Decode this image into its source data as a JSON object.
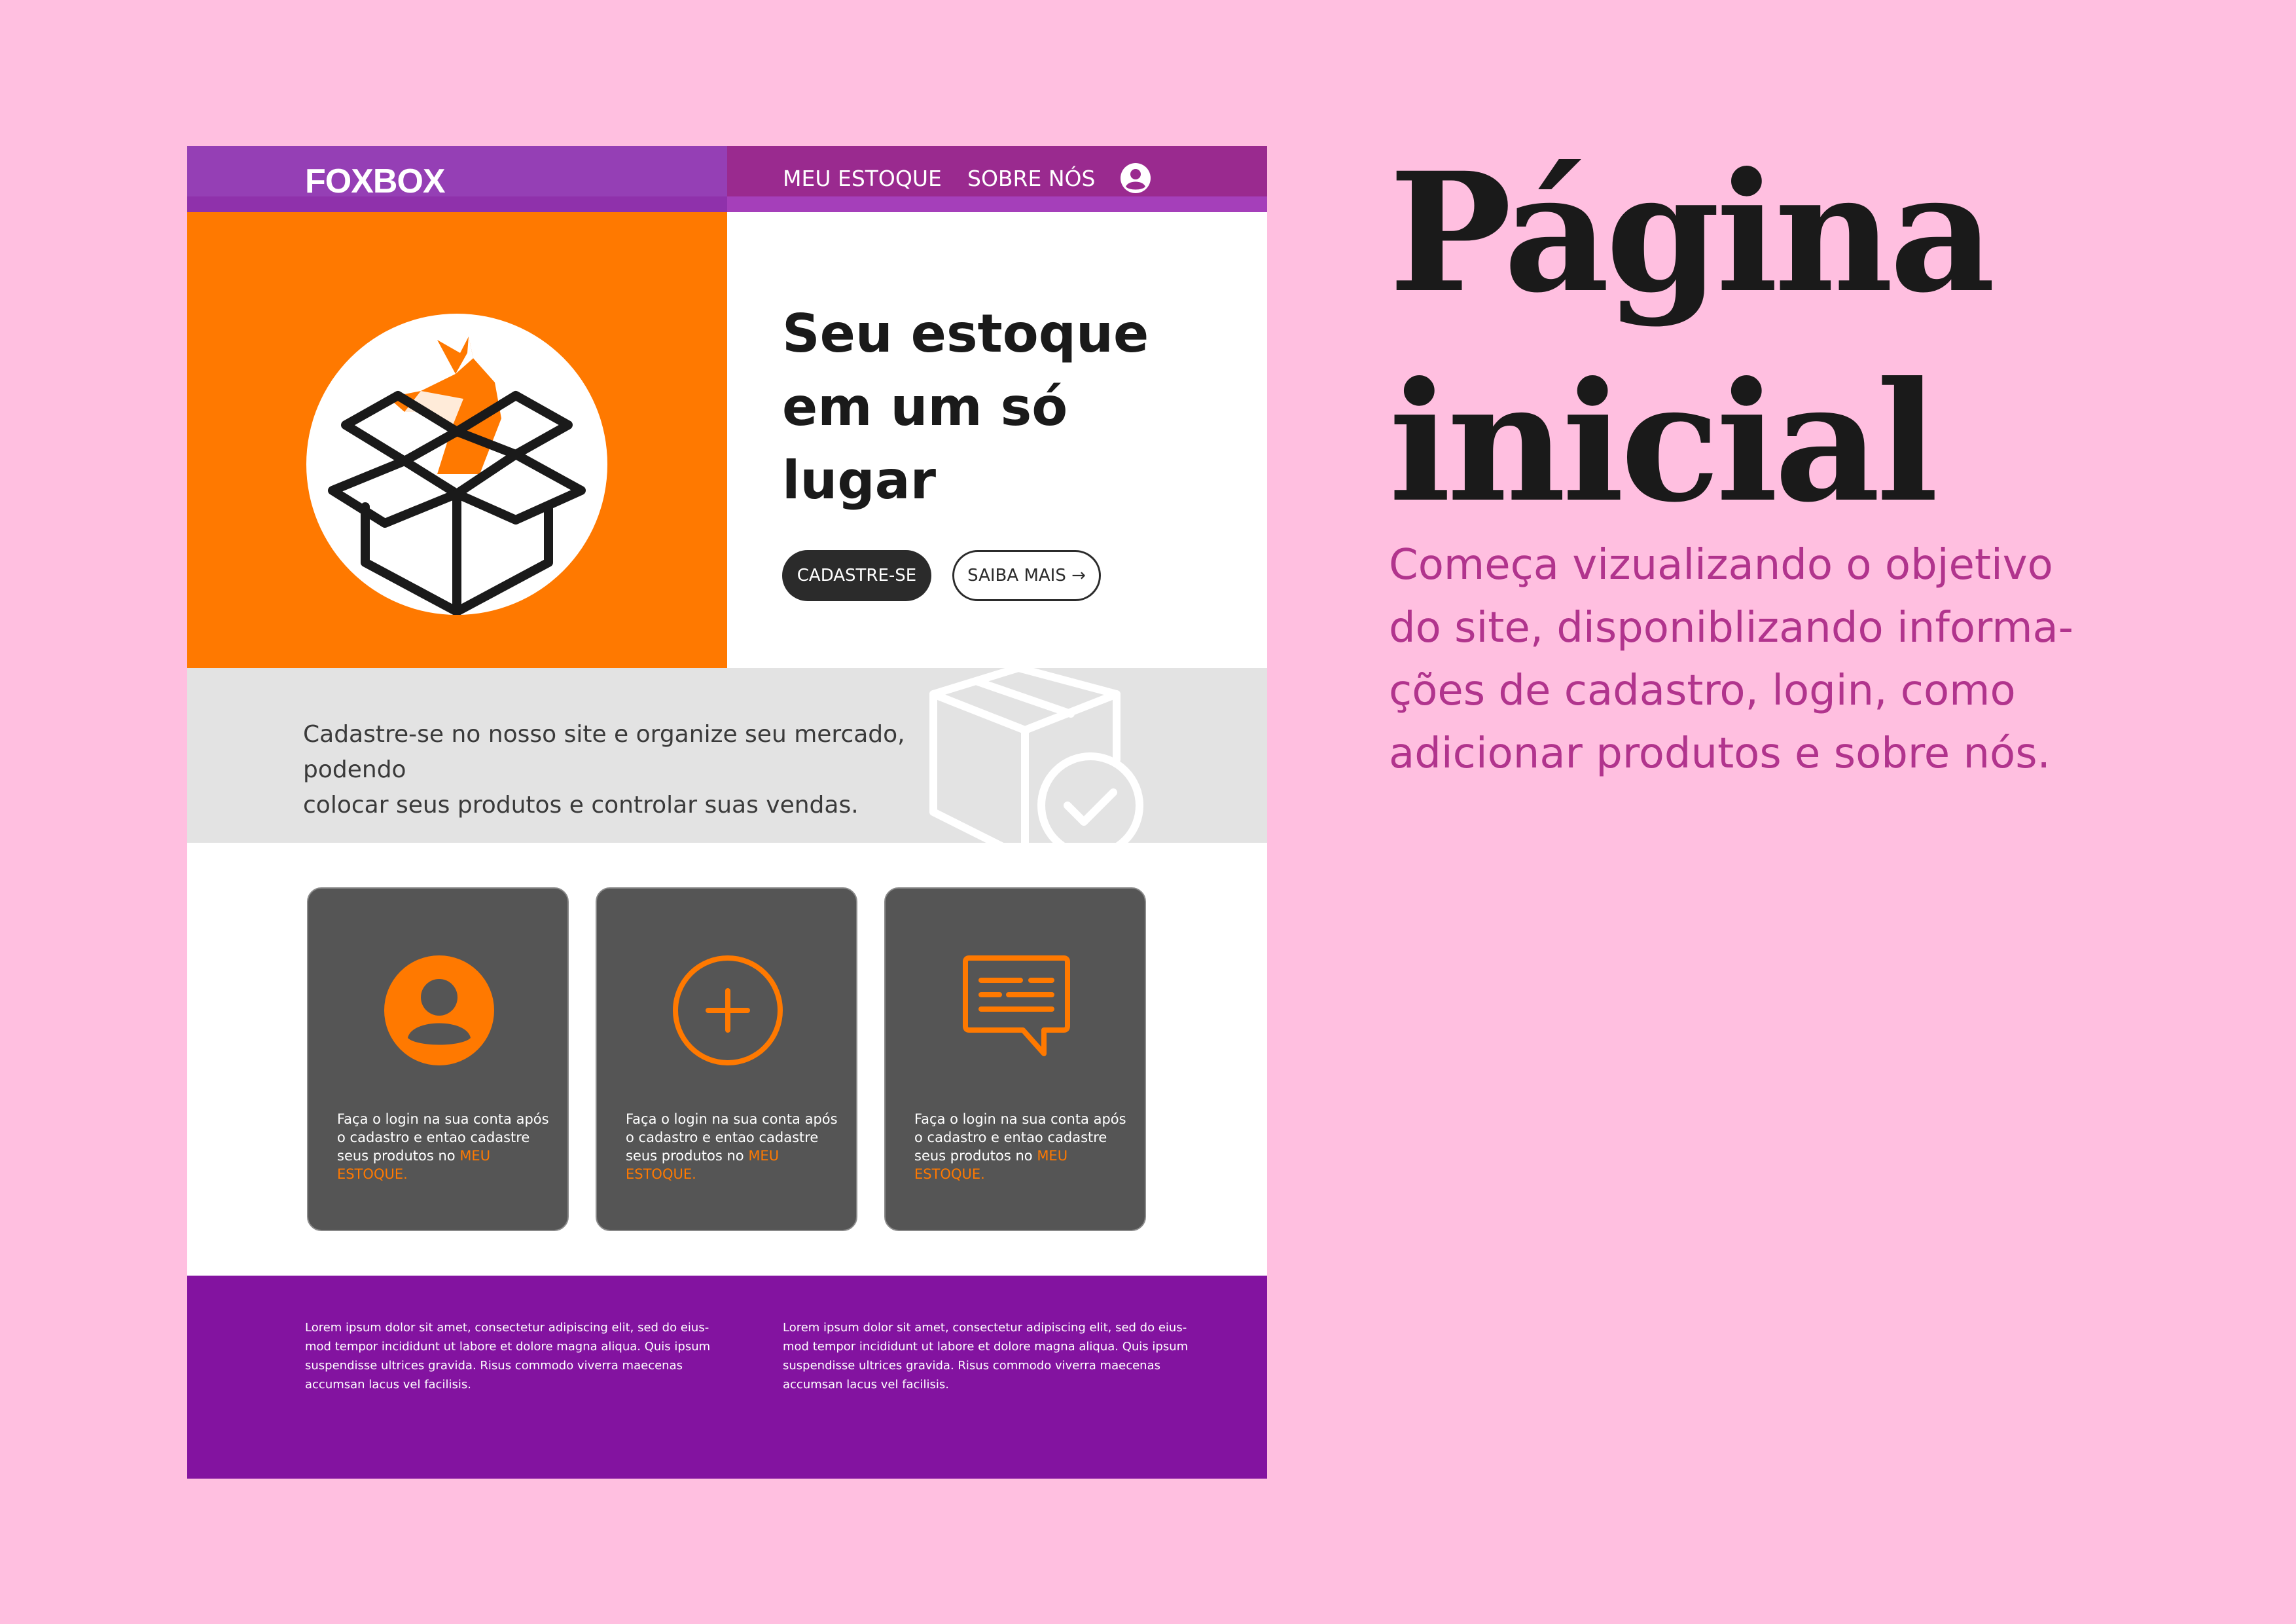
{
  "header": {
    "logo": "FOXBOX",
    "nav": [
      {
        "label": "MEU ESTOQUE"
      },
      {
        "label": "SOBRE NÓS"
      }
    ]
  },
  "hero": {
    "title_lines": [
      "Seu estoque",
      "em um só",
      "lugar"
    ],
    "signup_label": "CADASTRE-SE",
    "more_label": "SAIBA MAIS →"
  },
  "band": {
    "text_lines": [
      "Cadastre-se no nosso site e organize seu mercado, podendo",
      "colocar seus produtos e controlar suas vendas."
    ]
  },
  "cards": [
    {
      "icon": "user-icon",
      "lines": [
        "Faça o login na sua conta após",
        "o cadastro e entao cadastre",
        "seus produtos no "
      ],
      "link": "MEU ESTOQUE."
    },
    {
      "icon": "plus-icon",
      "lines": [
        "Faça o login na sua conta após",
        "o cadastro e entao cadastre",
        "seus produtos no "
      ],
      "link": "MEU ESTOQUE."
    },
    {
      "icon": "chat-icon",
      "lines": [
        "Faça o login na sua conta após",
        "o cadastro e entao cadastre",
        "seus produtos no "
      ],
      "link": "MEU ESTOQUE."
    }
  ],
  "footer": {
    "columns": [
      {
        "lines": [
          "Lorem ipsum dolor sit amet, consectetur adipiscing elit, sed do eius-",
          "mod tempor incididunt ut labore et dolore magna aliqua. Quis ipsum",
          "suspendisse ultrices gravida. Risus commodo viverra maecenas",
          "accumsan lacus vel facilisis."
        ]
      },
      {
        "lines": [
          "Lorem ipsum dolor sit amet, consectetur adipiscing elit, sed do eius-",
          "mod tempor incididunt ut labore et dolore magna aliqua. Quis ipsum",
          "suspendisse ultrices gravida. Risus commodo viverra maecenas",
          "accumsan lacus vel facilisis."
        ]
      }
    ]
  },
  "side": {
    "title_lines": [
      "Página",
      "inicial"
    ],
    "desc_lines": [
      "Começa vizualizando o objetivo",
      "do site, disponiblizando informa-",
      "ções de cadastro, login, como",
      "adicionar produtos e sobre nós."
    ]
  },
  "colors": {
    "background": "#ffbfe0",
    "header_purple": "#953fb5",
    "orange": "#ff7900",
    "card_gray": "#555555",
    "footer_purple": "#8313a0",
    "desc_magenta": "#b1348d"
  }
}
